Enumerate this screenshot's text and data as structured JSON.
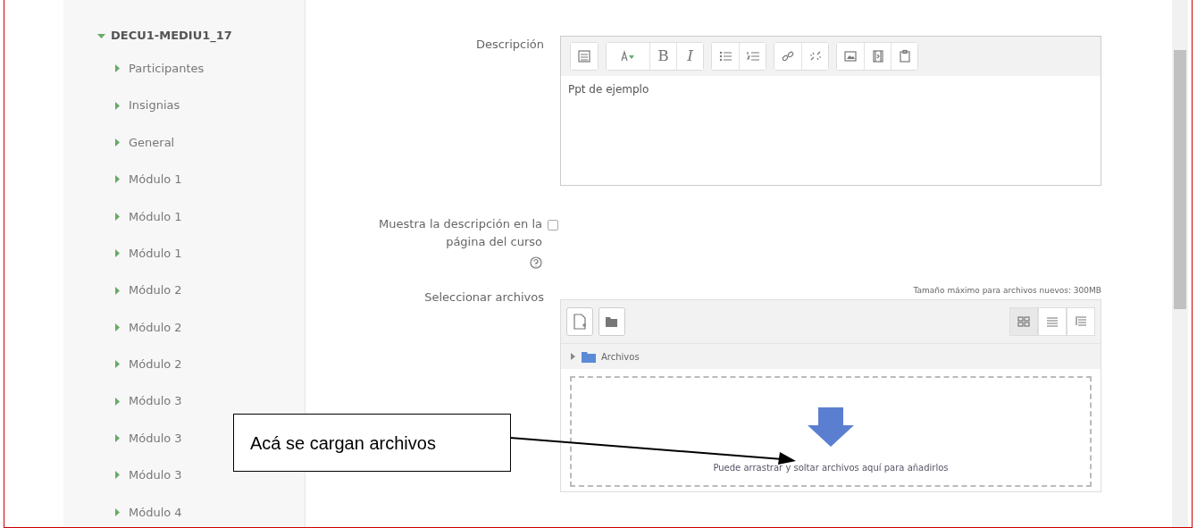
{
  "sidebar": {
    "items": [
      {
        "label": "DECU1-MEDIU1_17",
        "expanded": true,
        "children": [
          {
            "label": "Participantes",
            "expanded": false
          },
          {
            "label": "Insignias",
            "expanded": false
          },
          {
            "label": "General",
            "expanded": false
          },
          {
            "label": "Módulo 1",
            "expanded": false
          },
          {
            "label": "Módulo 1",
            "expanded": false
          },
          {
            "label": "Módulo 1",
            "expanded": false
          },
          {
            "label": "Módulo 2",
            "expanded": false
          },
          {
            "label": "Módulo 2",
            "expanded": false
          },
          {
            "label": "Módulo 2",
            "expanded": false
          },
          {
            "label": "Módulo 3",
            "expanded": false
          },
          {
            "label": "Módulo 3",
            "expanded": false
          },
          {
            "label": "Módulo 3",
            "expanded": false
          },
          {
            "label": "Módulo 4",
            "expanded": false
          }
        ]
      }
    ]
  },
  "description": {
    "label": "Descripción",
    "value": "Ppt de ejemplo",
    "toolbar": [
      [
        {
          "kind": "more"
        }
      ],
      [
        {
          "kind": "style"
        },
        {
          "kind": "bold",
          "label": "B"
        },
        {
          "kind": "italic",
          "label": "I"
        }
      ],
      [
        {
          "kind": "bullets"
        },
        {
          "kind": "numbers"
        }
      ],
      [
        {
          "kind": "link"
        },
        {
          "kind": "unlink"
        }
      ],
      [
        {
          "kind": "image"
        },
        {
          "kind": "media"
        },
        {
          "kind": "paste"
        }
      ]
    ]
  },
  "show_description": {
    "label": "Muestra la descripción en la página del curso",
    "checked": false
  },
  "files": {
    "label": "Seleccionar archivos",
    "max_size": "Tamaño máximo para archivos nuevos: 300MB",
    "folder": "Archivos",
    "views": [
      {
        "kind": "grid",
        "selected": true
      },
      {
        "kind": "list",
        "selected": false
      },
      {
        "kind": "tree",
        "selected": false
      }
    ],
    "drop_hint": "Puede arrastrar y soltar archivos aquí para añadirlos"
  },
  "callout": {
    "text": "Acá se cargan archivos"
  }
}
